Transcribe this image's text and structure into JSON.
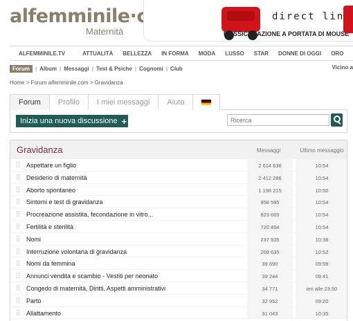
{
  "header": {
    "logo": "alfemminile·com",
    "logo_sub": "Maternità",
    "banner_brand": "direct line",
    "banner_tagline": "L'ASSICURAZIONE A PORTATA DI MOUSE"
  },
  "topnav": [
    "ALFEMMINILE.TV",
    "ATTUALITÀ",
    "BELLEZZA",
    "IN FORMA",
    "MODA",
    "LUSSO",
    "STAR",
    "DONNE DI OGGI",
    "ORO"
  ],
  "subnav": {
    "active": "Forum",
    "items": [
      "Album",
      "Messaggi",
      "Test & Psiche",
      "Cognomi",
      "Club"
    ],
    "right": "Vicino a"
  },
  "breadcrumb": "Home > Forum alfemminile.com > Gravidanza",
  "tabs": [
    "Forum",
    "Profilo",
    "I miei messaggi",
    "Aiuto"
  ],
  "actions": {
    "new_discussion": "Inizia una nuova discussione",
    "search_placeholder": "Ricerca"
  },
  "forum": {
    "title": "Gravidanza",
    "col_messages": "Messaggi",
    "col_last": "Ultimo messaggio",
    "rows": [
      {
        "name": "Aspettare un figlio",
        "count": "2 614 636",
        "last": "10:54"
      },
      {
        "name": "Desiderio di maternità",
        "count": "2 412 286",
        "last": "10:54"
      },
      {
        "name": "Aborto spontaneo",
        "count": "1 198 215",
        "last": "10:50"
      },
      {
        "name": "Sintomi e test di gravidanza",
        "count": "858 595",
        "last": "10:54"
      },
      {
        "name": "Procreazione assistita, fecondazione in vitro...",
        "count": "823 669",
        "last": "10:54"
      },
      {
        "name": "Fertilità e sterilità",
        "count": "720 494",
        "last": "10:54"
      },
      {
        "name": "Nomi",
        "count": "237 535",
        "last": "10:38"
      },
      {
        "name": "Interruzione volontaria di gravidanza",
        "count": "208 635",
        "last": "10:52"
      },
      {
        "name": "Nomi da femmina",
        "count": "39 690",
        "last": "09:59"
      },
      {
        "name": "Annunci vendita e scambio - Vestiti per neonato",
        "count": "39 244",
        "last": "09:41"
      },
      {
        "name": "Congedo di maternità, Diritti, Aspetti amministrativi",
        "count": "34 771",
        "last": "ieri alle 23:50"
      },
      {
        "name": "Parto",
        "count": "32 952",
        "last": "09:20"
      },
      {
        "name": "Allattamento",
        "count": "31 043",
        "last": "10:35"
      }
    ]
  },
  "colors": {
    "accent": "#1f5c57",
    "brand": "#8a7f6b",
    "title": "#7a2a45",
    "banner_red": "#d0141b"
  }
}
